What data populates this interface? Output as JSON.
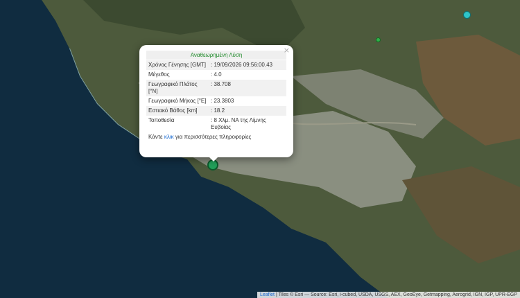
{
  "popup": {
    "title": "Αναθεωρημένη Λύση",
    "close_icon": "×",
    "rows": [
      {
        "label": "Χρόνος Γένησης [GMT]",
        "value": ": 19/09/2026 09:56:00.43"
      },
      {
        "label": "Μέγεθος",
        "value": ": 4.0"
      },
      {
        "label": "Γεωγραφικό Πλάτος [°N]",
        "value": ": 38.708"
      },
      {
        "label": "Γεωγραφικό Μήκος [°E]",
        "value": ": 23.3803"
      },
      {
        "label": "Εστιακό Βάθος [km]",
        "value": ": 18.2"
      },
      {
        "label": "Τοποθεσία",
        "value": ": 8 Χλμ. ΝΑ της Λίμνης Ευβοίας"
      }
    ],
    "more_prefix": "Κάντε",
    "more_link": "κλικ",
    "more_suffix": "για περισσότερες πληροφορίες"
  },
  "attribution": {
    "leaflet": "Leaflet",
    "text": "| Tiles © Esri — Source: Esri, i-cubed, USDA, USGS, AEX, GeoEye, Getmapping, Aerogrid, IGN, IGP, UPR-EGP"
  },
  "markers": {
    "main_color": "#22a05a",
    "cyan_color": "#2fc4c9",
    "small_color": "#30b04a"
  }
}
